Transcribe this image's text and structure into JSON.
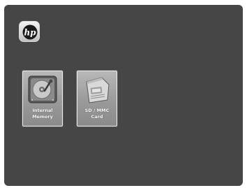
{
  "logo": {
    "text": "hp",
    "icon": "hp-logo-icon"
  },
  "storage": [
    {
      "line1": "Internal",
      "line2": "Memory",
      "icon": "hard-drive-icon"
    },
    {
      "line1": "SD / MMC",
      "line2": "Card",
      "icon": "memory-card-icon"
    }
  ],
  "colors": {
    "background": "#464646",
    "tile": "#9a9a9a",
    "tile_border": "#ededed",
    "label": "#ffffff"
  }
}
